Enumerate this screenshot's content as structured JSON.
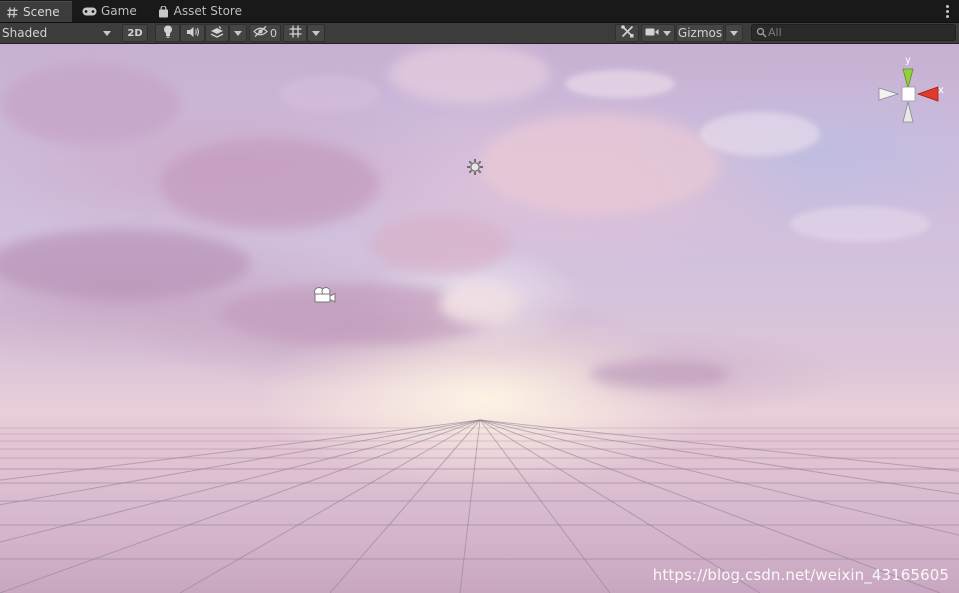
{
  "tabs": [
    {
      "label": "Scene",
      "icon": "hash-icon",
      "active": true
    },
    {
      "label": "Game",
      "icon": "gamepad-icon",
      "active": false
    },
    {
      "label": "Asset Store",
      "icon": "bag-icon",
      "active": false
    }
  ],
  "toolbar": {
    "draw_mode": "Shaded",
    "toggle_2d": "2D",
    "hidden_count": "0",
    "gizmos_label": "Gizmos",
    "search_placeholder": "All"
  },
  "orientation_gizmo": {
    "y_label": "y",
    "x_label": "x",
    "y_color": "#8fd13c",
    "x_color": "#e23a2a"
  },
  "scene_icons": [
    "sun-icon",
    "camera-icon"
  ],
  "watermark": "https://blog.csdn.net/weixin_43165605",
  "colors": {
    "tabbar_bg": "#191919",
    "toolbar_bg": "#3c3c3c",
    "sky_top": "#c7b0d2",
    "horizon_glow": "#fff4e4"
  }
}
